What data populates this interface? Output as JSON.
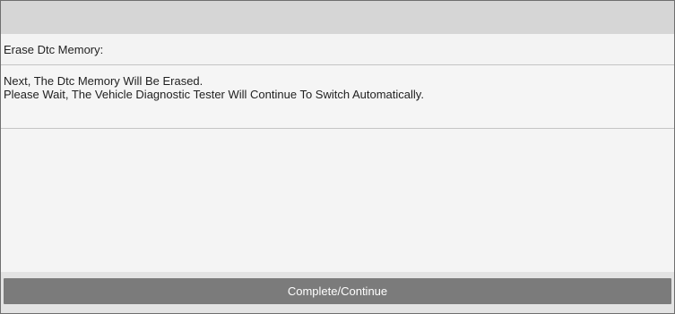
{
  "header": {
    "title": ""
  },
  "section": {
    "heading": "Erase Dtc Memory:"
  },
  "message": {
    "line1": "Next, The Dtc Memory Will Be Erased.",
    "line2": "Please Wait, The Vehicle Diagnostic Tester Will Continue To Switch Automatically."
  },
  "actions": {
    "continue_label": "Complete/Continue"
  },
  "colors": {
    "title_bar": "#d6d6d6",
    "button": "#7b7b7b",
    "button_text": "#ffffff",
    "background": "#f4f4f4"
  }
}
